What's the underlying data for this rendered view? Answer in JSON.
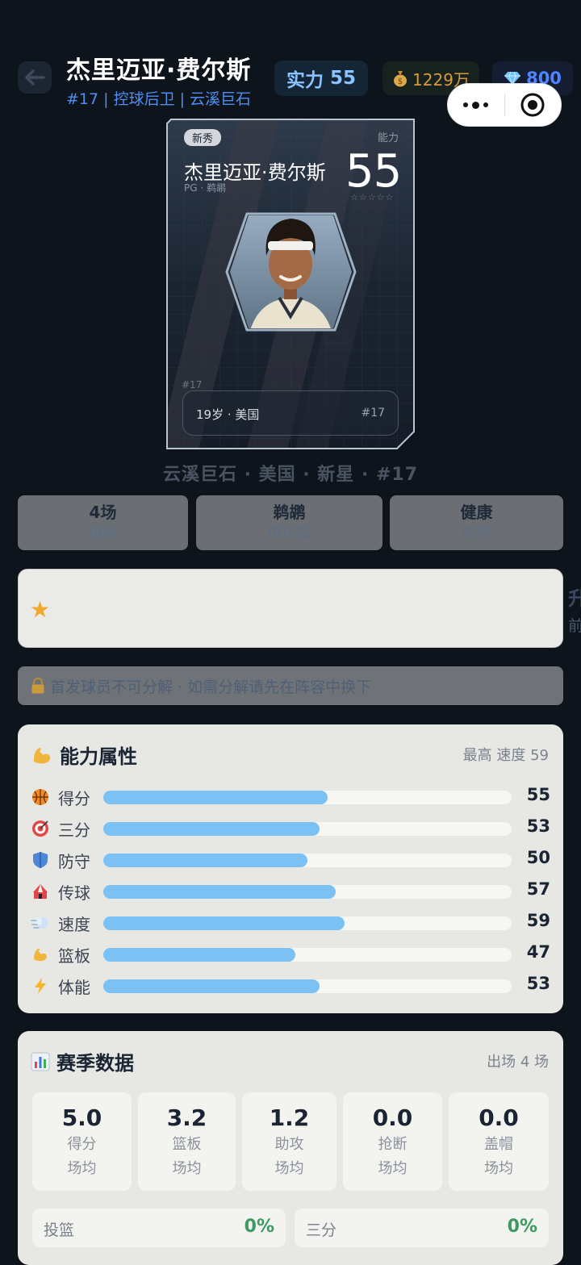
{
  "header": {
    "name": "杰里迈亚·费尔斯",
    "subtitle": "#17 | 控球后卫 | 云溪巨石",
    "power_label": "实力",
    "power_value": "55",
    "money": "1229万",
    "gems": "800"
  },
  "card": {
    "tag": "新秀",
    "ability_label": "能力",
    "name": "杰里迈亚·费尔斯",
    "position_team": "PG · 鹈鹕",
    "rating": "55",
    "stars": "☆☆☆☆☆",
    "number_small": "#17",
    "age_country": "19岁 · 美国",
    "number": "#17",
    "jersey_text": "NEWAC"
  },
  "summary_line": "云溪巨石 · 美国 · 新星 · #17",
  "tiles": [
    {
      "top": "4场",
      "bottom": "出场"
    },
    {
      "top": "鹈鹕",
      "bottom": "俱乐部"
    },
    {
      "top": "健康",
      "bottom": "伤停"
    }
  ],
  "edge_text": {
    "line1": "升",
    "line2": "前"
  },
  "lock_notice": "首发球员不可分解 · 如需分解请先在阵容中换下",
  "attributes": {
    "title": "能力属性",
    "meta": "最高 速度 59",
    "max_value": 100,
    "items": [
      {
        "icon": "basketball-icon",
        "label": "得分",
        "value": 55
      },
      {
        "icon": "target-icon",
        "label": "三分",
        "value": 53
      },
      {
        "icon": "shield-icon",
        "label": "防守",
        "value": 50
      },
      {
        "icon": "circus-tent-icon",
        "label": "传球",
        "value": 57
      },
      {
        "icon": "dash-icon",
        "label": "速度",
        "value": 59
      },
      {
        "icon": "flexed-biceps-icon",
        "label": "篮板",
        "value": 47
      },
      {
        "icon": "lightning-icon",
        "label": "体能",
        "value": 53
      }
    ]
  },
  "season": {
    "title": "赛季数据",
    "meta": "出场 4 场",
    "stats": [
      {
        "value": "5.0",
        "label": "得分",
        "sub": "场均"
      },
      {
        "value": "3.2",
        "label": "篮板",
        "sub": "场均"
      },
      {
        "value": "1.2",
        "label": "助攻",
        "sub": "场均"
      },
      {
        "value": "0.0",
        "label": "抢断",
        "sub": "场均"
      },
      {
        "value": "0.0",
        "label": "盖帽",
        "sub": "场均"
      }
    ],
    "percentages": [
      {
        "label": "投篮",
        "value": "0%"
      },
      {
        "label": "三分",
        "value": "0%"
      }
    ]
  },
  "colors": {
    "accent_blue": "#4f8ef0",
    "bar_fill": "#7cc1f3",
    "money": "#d79a3a",
    "gem": "#4f83ff",
    "success": "#3c9a62"
  }
}
